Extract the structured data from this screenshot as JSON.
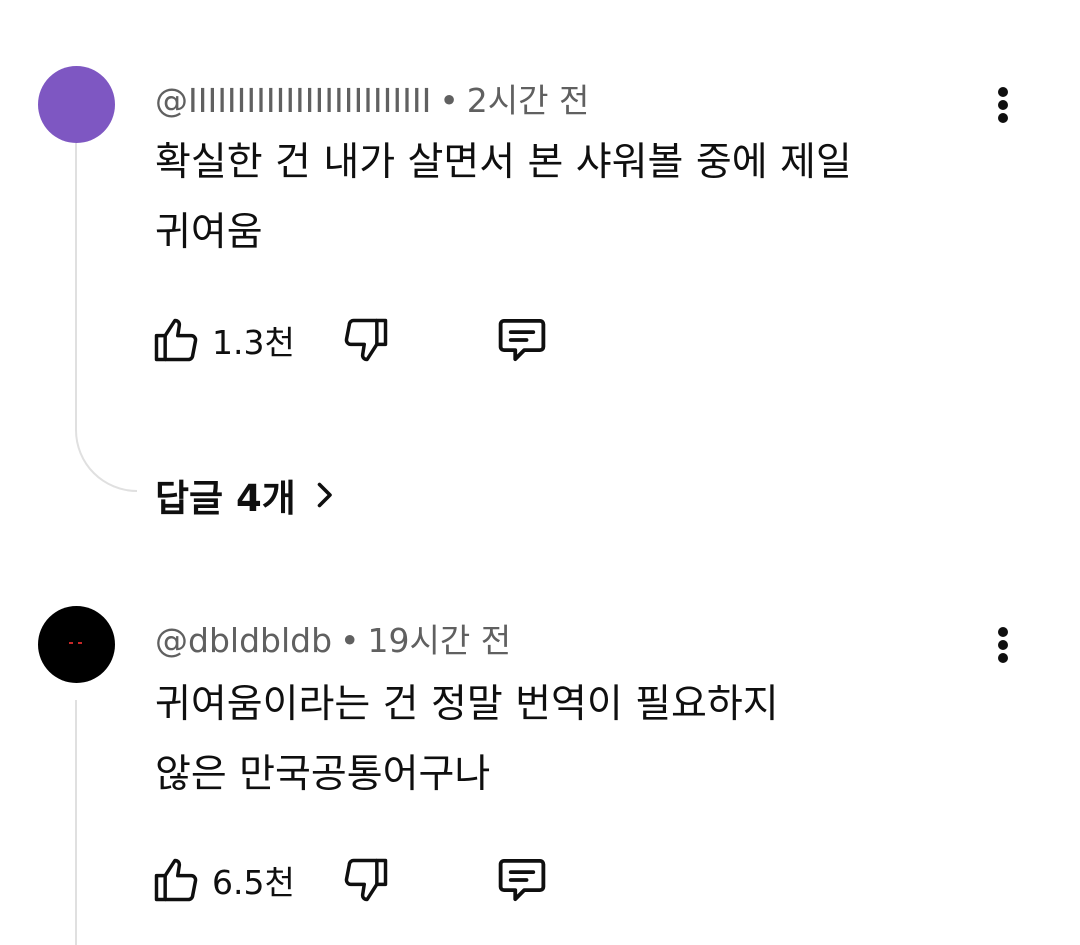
{
  "comments": [
    {
      "author": "@IIIIIIIIIIIIIIIIIIIIIIIII",
      "time": "2시간 전",
      "separator": "•",
      "text_lines": [
        "확실한 건 내가 살면서 본 샤워볼 중에 제일",
        "귀여움"
      ],
      "likes": "1.3천",
      "avatar_color": "#7e57c2",
      "replies_label": "답글 4개"
    },
    {
      "author": "@dbldbldb",
      "time": "19시간 전",
      "separator": "•",
      "text_lines": [
        "귀여움이라는 건 정말 번역이 필요하지",
        "않은 만국공통어구나"
      ],
      "likes": "6.5천",
      "avatar_color": "#000000"
    }
  ],
  "icons": {
    "like": "thumbs-up-icon",
    "dislike": "thumbs-down-icon",
    "reply": "comment-icon",
    "more": "more-vert-icon",
    "chevron": "chevron-right-icon"
  }
}
